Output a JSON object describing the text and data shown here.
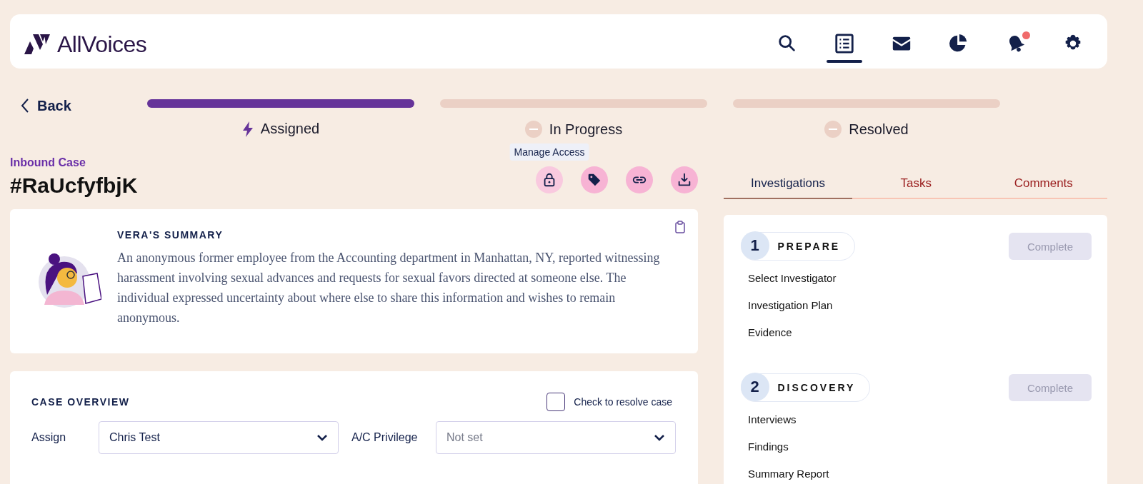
{
  "header": {
    "logo": "AllVoices",
    "nav": [
      {
        "kind": "search",
        "selected": false,
        "badge": false
      },
      {
        "kind": "list",
        "selected": true,
        "badge": false
      },
      {
        "kind": "mail",
        "selected": false,
        "badge": false
      },
      {
        "kind": "chart",
        "selected": false,
        "badge": false
      },
      {
        "kind": "bell",
        "selected": false,
        "badge": true
      },
      {
        "kind": "gear",
        "selected": false,
        "badge": false
      }
    ]
  },
  "back": "Back",
  "progress": [
    {
      "label": "Assigned",
      "active": true
    },
    {
      "label": "In Progress",
      "active": false
    },
    {
      "label": "Resolved",
      "active": false
    }
  ],
  "case": {
    "type": "Inbound Case",
    "id": "#RaUcfyfbjK",
    "actions": [
      {
        "kind": "lock",
        "tooltip": "Manage Access"
      },
      {
        "kind": "tag"
      },
      {
        "kind": "link"
      },
      {
        "kind": "download"
      }
    ]
  },
  "summary": {
    "title": "VERA'S SUMMARY",
    "text": "An anonymous former employee from the Accounting department in Manhattan, NY, reported witnessing harassment involving sexual advances and requests for sexual favors directed at someone else. The individual expressed uncertainty about where else to share this information and wishes to remain anonymous."
  },
  "overview": {
    "title": "CASE OVERVIEW",
    "resolve": {
      "label": "Check to resolve case",
      "checked": false
    },
    "fields": [
      {
        "label": "Assign",
        "value": "Chris Test"
      },
      {
        "label": "A/C Privilege",
        "placeholder": "Not set"
      }
    ]
  },
  "tabs": [
    {
      "label": "Investigations",
      "selected": true
    },
    {
      "label": "Tasks",
      "selected": false
    },
    {
      "label": "Comments",
      "selected": false
    }
  ],
  "phases": [
    {
      "number": "1",
      "title": "PREPARE",
      "button": "Complete",
      "items": [
        "Select Investigator",
        "Investigation Plan",
        "Evidence"
      ]
    },
    {
      "number": "2",
      "title": "DISCOVERY",
      "button": "Complete",
      "items": [
        "Interviews",
        "Findings",
        "Summary Report"
      ]
    }
  ]
}
